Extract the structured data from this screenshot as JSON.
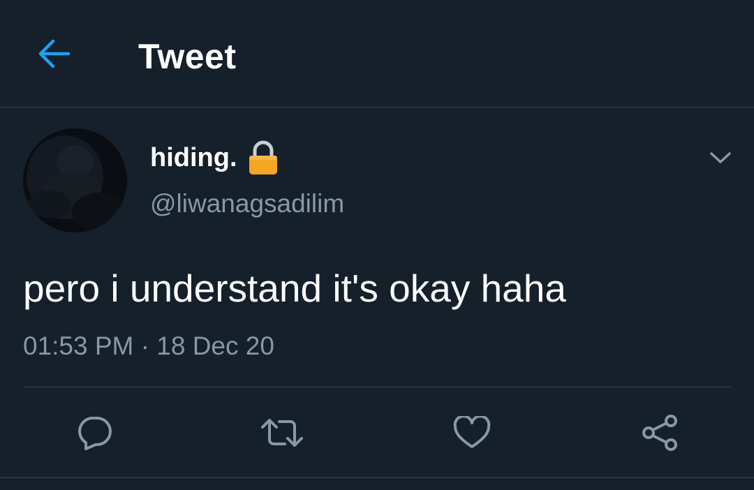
{
  "header": {
    "title": "Tweet"
  },
  "tweet": {
    "author_name": "hiding.",
    "author_handle": "@liwanagsadilim",
    "text": "pero i understand it's okay haha",
    "time": "01:53 PM",
    "separator": "·",
    "date": "18 Dec 20"
  },
  "icons": {
    "back": "arrow-left-icon",
    "lock": "lock-icon",
    "more": "chevron-down-icon",
    "reply": "reply-icon",
    "retweet": "retweet-icon",
    "like": "heart-icon",
    "share": "share-icon"
  },
  "colors": {
    "background": "#15202b",
    "accent": "#1da1f2",
    "secondary_text": "#8899a6",
    "divider": "#38444d",
    "lock": "#f5a623"
  }
}
